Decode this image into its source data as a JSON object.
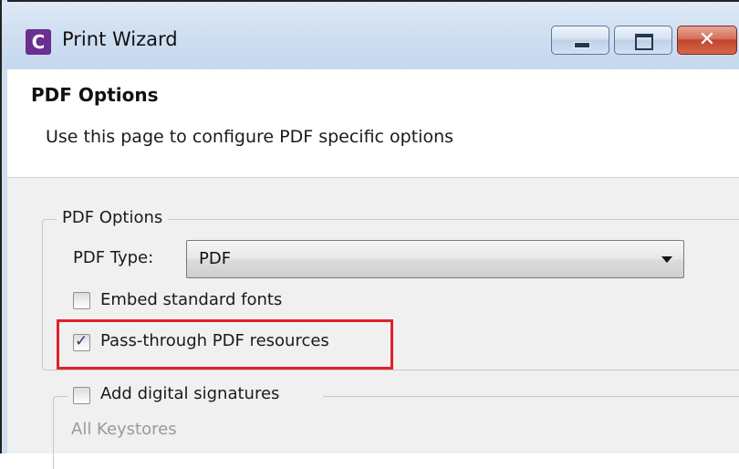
{
  "window": {
    "title": "Print Wizard",
    "app_icon_letter": "C",
    "app_icon_color": "#6b2e91",
    "controls": {
      "minimize_icon": "minimize-icon",
      "maximize_icon": "maximize-icon",
      "close_icon": "close-icon",
      "close_glyph": "✕"
    }
  },
  "header": {
    "title": "PDF Options",
    "description": "Use this page to configure PDF specific options"
  },
  "pdf_options_group": {
    "legend": "PDF Options",
    "pdf_type_label": "PDF Type:",
    "pdf_type_value": "PDF",
    "embed_fonts": {
      "label": "Embed standard fonts",
      "checked": false
    },
    "pass_through": {
      "label": "Pass-through PDF resources",
      "checked": true,
      "check_glyph": "✓"
    },
    "highlight_color": "#e3202a"
  },
  "signatures_group": {
    "add_signatures": {
      "label": "Add digital signatures",
      "checked": false
    },
    "keystores_label": "All Keystores"
  }
}
